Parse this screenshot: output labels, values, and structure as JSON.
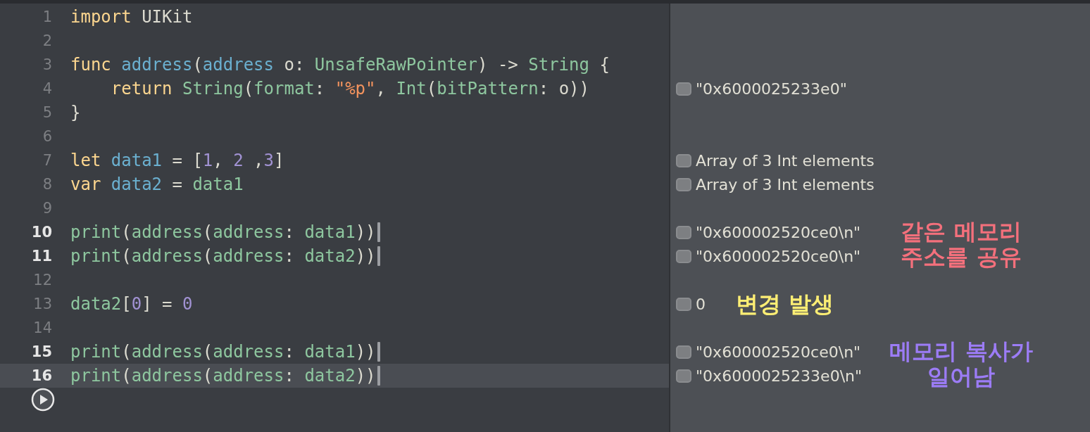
{
  "editor": {
    "lines": [
      {
        "number": "1",
        "marked": false,
        "selected": false,
        "tokens": [
          {
            "text": "import",
            "kind": "keyword"
          },
          {
            "text": " UIKit",
            "kind": "plain"
          }
        ]
      },
      {
        "number": "2",
        "marked": false,
        "selected": false
      },
      {
        "number": "3",
        "marked": false,
        "selected": false,
        "tokens": [
          {
            "text": "func",
            "kind": "keyword"
          },
          {
            "text": " address",
            "kind": "decl"
          },
          {
            "text": "(",
            "kind": "plain"
          },
          {
            "text": "address",
            "kind": "decl"
          },
          {
            "text": " o: ",
            "kind": "plain"
          },
          {
            "text": "UnsafeRawPointer",
            "kind": "type"
          },
          {
            "text": ") -> ",
            "kind": "plain"
          },
          {
            "text": "String",
            "kind": "type"
          },
          {
            "text": " {",
            "kind": "plain"
          }
        ]
      },
      {
        "number": "4",
        "marked": false,
        "selected": false,
        "result": "\"0x6000025233e0\"",
        "tokens": [
          {
            "text": "    return",
            "kind": "keyword"
          },
          {
            "text": " String",
            "kind": "type"
          },
          {
            "text": "(",
            "kind": "plain"
          },
          {
            "text": "format",
            "kind": "type"
          },
          {
            "text": ": ",
            "kind": "plain"
          },
          {
            "text": "\"%p\"",
            "kind": "string"
          },
          {
            "text": ", ",
            "kind": "plain"
          },
          {
            "text": "Int",
            "kind": "type"
          },
          {
            "text": "(",
            "kind": "plain"
          },
          {
            "text": "bitPattern",
            "kind": "type"
          },
          {
            "text": ": o))",
            "kind": "plain"
          }
        ]
      },
      {
        "number": "5",
        "marked": false,
        "selected": false,
        "tokens": [
          {
            "text": "}",
            "kind": "plain"
          }
        ]
      },
      {
        "number": "6",
        "marked": false,
        "selected": false
      },
      {
        "number": "7",
        "marked": false,
        "selected": false,
        "result": "Array of 3 Int elements",
        "tokens": [
          {
            "text": "let",
            "kind": "keyword"
          },
          {
            "text": " data1",
            "kind": "decl"
          },
          {
            "text": " = [",
            "kind": "plain"
          },
          {
            "text": "1",
            "kind": "number"
          },
          {
            "text": ", ",
            "kind": "plain"
          },
          {
            "text": "2",
            "kind": "number"
          },
          {
            "text": " ,",
            "kind": "plain"
          },
          {
            "text": "3",
            "kind": "number"
          },
          {
            "text": "]",
            "kind": "plain"
          }
        ]
      },
      {
        "number": "8",
        "marked": false,
        "selected": false,
        "result": "Array of 3 Int elements",
        "tokens": [
          {
            "text": "var",
            "kind": "keyword"
          },
          {
            "text": " data2",
            "kind": "decl"
          },
          {
            "text": " = ",
            "kind": "plain"
          },
          {
            "text": "data1",
            "kind": "type"
          }
        ]
      },
      {
        "number": "9",
        "marked": false,
        "selected": false
      },
      {
        "number": "10",
        "marked": true,
        "selected": false,
        "result": "\"0x600002520ce0\\n\"",
        "note": {
          "kind": "side",
          "color": "#f4707c",
          "lines": [
            "같은 메모리",
            "주소를 공유"
          ]
        },
        "tokens": [
          {
            "text": "print",
            "kind": "type"
          },
          {
            "text": "(",
            "kind": "plain"
          },
          {
            "text": "address",
            "kind": "type"
          },
          {
            "text": "(",
            "kind": "plain"
          },
          {
            "text": "address",
            "kind": "type"
          },
          {
            "text": ": ",
            "kind": "plain"
          },
          {
            "text": "data1",
            "kind": "type"
          },
          {
            "text": "))",
            "kind": "plain"
          }
        ]
      },
      {
        "number": "11",
        "marked": true,
        "selected": false,
        "result": "\"0x600002520ce0\\n\"",
        "tokens": [
          {
            "text": "print",
            "kind": "type"
          },
          {
            "text": "(",
            "kind": "plain"
          },
          {
            "text": "address",
            "kind": "type"
          },
          {
            "text": "(",
            "kind": "plain"
          },
          {
            "text": "address",
            "kind": "type"
          },
          {
            "text": ": ",
            "kind": "plain"
          },
          {
            "text": "data2",
            "kind": "type"
          },
          {
            "text": "))",
            "kind": "plain"
          }
        ]
      },
      {
        "number": "12",
        "marked": false,
        "selected": false
      },
      {
        "number": "13",
        "marked": false,
        "selected": false,
        "result": "0",
        "note": {
          "kind": "inline",
          "color": "#fdee74",
          "lines": [
            "변경 발생"
          ]
        },
        "tokens": [
          {
            "text": "data2",
            "kind": "type"
          },
          {
            "text": "[",
            "kind": "plain"
          },
          {
            "text": "0",
            "kind": "number"
          },
          {
            "text": "] = ",
            "kind": "plain"
          },
          {
            "text": "0",
            "kind": "number"
          }
        ]
      },
      {
        "number": "14",
        "marked": false,
        "selected": false
      },
      {
        "number": "15",
        "marked": true,
        "selected": false,
        "result": "\"0x600002520ce0\\n\"",
        "note": {
          "kind": "side",
          "color": "#9c7cf6",
          "lines": [
            "메모리 복사가",
            "일어남"
          ]
        },
        "tokens": [
          {
            "text": "print",
            "kind": "type"
          },
          {
            "text": "(",
            "kind": "plain"
          },
          {
            "text": "address",
            "kind": "type"
          },
          {
            "text": "(",
            "kind": "plain"
          },
          {
            "text": "address",
            "kind": "type"
          },
          {
            "text": ": ",
            "kind": "plain"
          },
          {
            "text": "data1",
            "kind": "type"
          },
          {
            "text": "))",
            "kind": "plain"
          }
        ]
      },
      {
        "number": "16",
        "marked": true,
        "selected": true,
        "result": "\"0x6000025233e0\\n\"",
        "tokens": [
          {
            "text": "print",
            "kind": "type"
          },
          {
            "text": "(",
            "kind": "plain"
          },
          {
            "text": "address",
            "kind": "type"
          },
          {
            "text": "(",
            "kind": "plain"
          },
          {
            "text": "address",
            "kind": "type"
          },
          {
            "text": ": ",
            "kind": "plain"
          },
          {
            "text": "data2",
            "kind": "type"
          },
          {
            "text": "))",
            "kind": "plain"
          }
        ]
      }
    ]
  }
}
